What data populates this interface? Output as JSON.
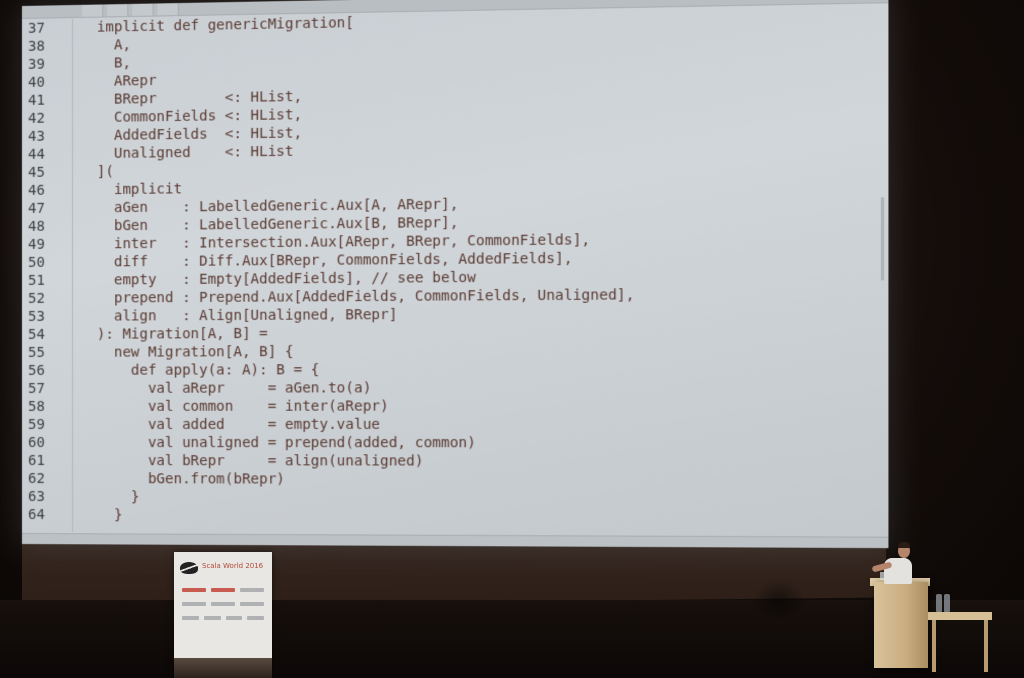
{
  "editor": {
    "tabs": [
      "",
      "",
      "",
      ""
    ],
    "status": "",
    "lines": [
      {
        "num": "37",
        "code": "  implicit def genericMigration["
      },
      {
        "num": "38",
        "code": "    A,"
      },
      {
        "num": "39",
        "code": "    B,"
      },
      {
        "num": "40",
        "code": "    ARepr"
      },
      {
        "num": "41",
        "code": "    BRepr        <: HList,"
      },
      {
        "num": "42",
        "code": "    CommonFields <: HList,"
      },
      {
        "num": "43",
        "code": "    AddedFields  <: HList,"
      },
      {
        "num": "44",
        "code": "    Unaligned    <: HList"
      },
      {
        "num": "45",
        "code": "  ]("
      },
      {
        "num": "46",
        "code": "    implicit"
      },
      {
        "num": "47",
        "code": "    aGen    : LabelledGeneric.Aux[A, ARepr],"
      },
      {
        "num": "48",
        "code": "    bGen    : LabelledGeneric.Aux[B, BRepr],"
      },
      {
        "num": "49",
        "code": "    inter   : Intersection.Aux[ARepr, BRepr, CommonFields],"
      },
      {
        "num": "50",
        "code": "    diff    : Diff.Aux[BRepr, CommonFields, AddedFields],"
      },
      {
        "num": "51",
        "code": "    empty   : Empty[AddedFields], // see below"
      },
      {
        "num": "52",
        "code": "    prepend : Prepend.Aux[AddedFields, CommonFields, Unaligned],"
      },
      {
        "num": "53",
        "code": "    align   : Align[Unaligned, BRepr]"
      },
      {
        "num": "54",
        "code": "  ): Migration[A, B] ="
      },
      {
        "num": "55",
        "code": "    new Migration[A, B] {"
      },
      {
        "num": "56",
        "code": "      def apply(a: A): B = {"
      },
      {
        "num": "57",
        "code": "        val aRepr     = aGen.to(a)"
      },
      {
        "num": "58",
        "code": "        val common    = inter(aRepr)"
      },
      {
        "num": "59",
        "code": "        val added     = empty.value"
      },
      {
        "num": "60",
        "code": "        val unaligned = prepend(added, common)"
      },
      {
        "num": "61",
        "code": "        val bRepr     = align(unaligned)"
      },
      {
        "num": "62",
        "code": "        bGen.from(bRepr)"
      },
      {
        "num": "63",
        "code": "      }"
      },
      {
        "num": "64",
        "code": "    }"
      }
    ]
  },
  "banner": {
    "title": "Scala World 2016"
  },
  "colors": {
    "code_text": "#5a3a32",
    "line_numbers": "#3c3f42",
    "screen": "#c9ced3",
    "banner_title": "#b34a3a"
  }
}
